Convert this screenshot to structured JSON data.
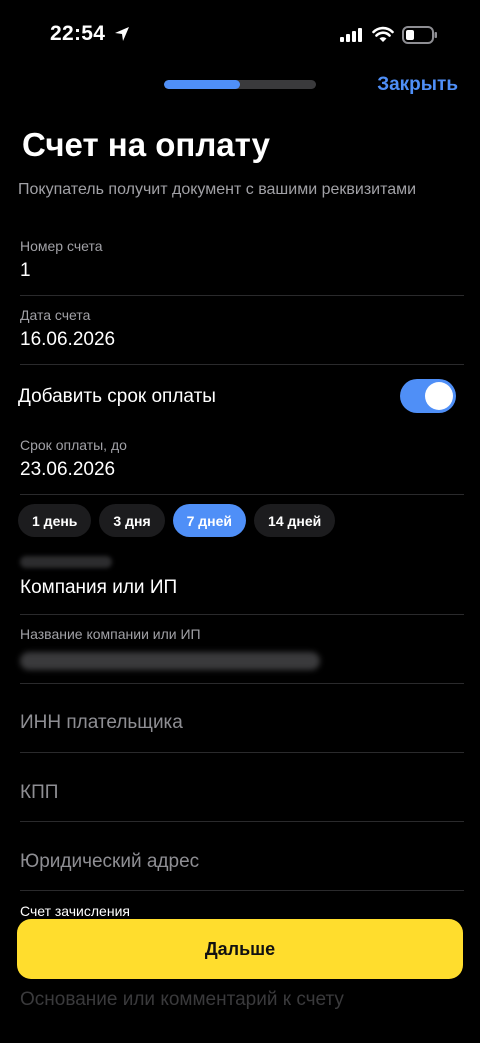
{
  "status_bar": {
    "time": "22:54"
  },
  "header": {
    "progress_fraction": 0.5,
    "close_label": "Закрыть",
    "title": "Счет на оплату",
    "subtitle": "Покупатель получит документ с вашими реквизитами"
  },
  "fields": {
    "invoice_number": {
      "label": "Номер счета",
      "value": "1"
    },
    "invoice_date": {
      "label": "Дата счета",
      "value": "16.06.2026"
    },
    "due_toggle": {
      "label": "Добавить срок оплаты",
      "on": true
    },
    "due_date": {
      "label": "Срок оплаты, до",
      "value": "23.06.2026"
    },
    "due_chips": [
      {
        "label": "1 день",
        "active": false
      },
      {
        "label": "3 дня",
        "active": false
      },
      {
        "label": "7 дней",
        "active": true
      },
      {
        "label": "14 дней",
        "active": false
      }
    ],
    "payer_type": {
      "value": "Компания или ИП"
    },
    "company_name": {
      "label": "Название компании или ИП"
    },
    "inn": {
      "placeholder": "ИНН плательщика"
    },
    "kpp": {
      "placeholder": "КПП"
    },
    "address": {
      "placeholder": "Юридический адрес"
    },
    "account": {
      "label": "Счет зачисления"
    },
    "comment": {
      "placeholder": "Основание или комментарий к счету"
    }
  },
  "footer": {
    "next_label": "Дальше"
  },
  "colors": {
    "accent": "#4f8ff7",
    "primary_button": "#ffdd2d",
    "background": "#000000"
  }
}
